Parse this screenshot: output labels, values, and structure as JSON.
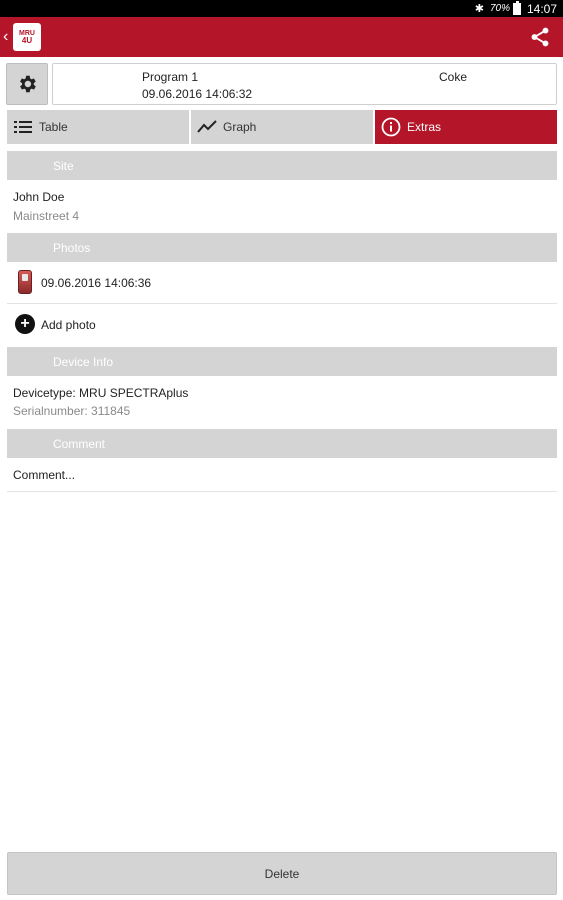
{
  "status_bar": {
    "battery": "70%",
    "time": "14:07"
  },
  "app": {
    "logo_line1": "MRU",
    "logo_line2": "4U",
    "brand_color": "#b51528"
  },
  "header": {
    "program": "Program 1",
    "datetime": "09.06.2016 14:06:32",
    "fuel": "Coke"
  },
  "tabs": [
    {
      "label": "Table",
      "icon": "list-icon",
      "active": false
    },
    {
      "label": "Graph",
      "icon": "trend-icon",
      "active": false
    },
    {
      "label": "Extras",
      "icon": "info-icon",
      "active": true
    }
  ],
  "site": {
    "heading": "Site",
    "name": "John Doe",
    "address": "Mainstreet 4"
  },
  "photos": {
    "heading": "Photos",
    "items": [
      {
        "timestamp": "09.06.2016 14:06:36"
      }
    ],
    "add_label": "Add photo"
  },
  "device": {
    "heading": "Device Info",
    "type": "Devicetype: MRU SPECTRAplus",
    "serial": "Serialnumber: 311845"
  },
  "comment": {
    "heading": "Comment",
    "placeholder": "Comment..."
  },
  "actions": {
    "delete_label": "Delete"
  }
}
